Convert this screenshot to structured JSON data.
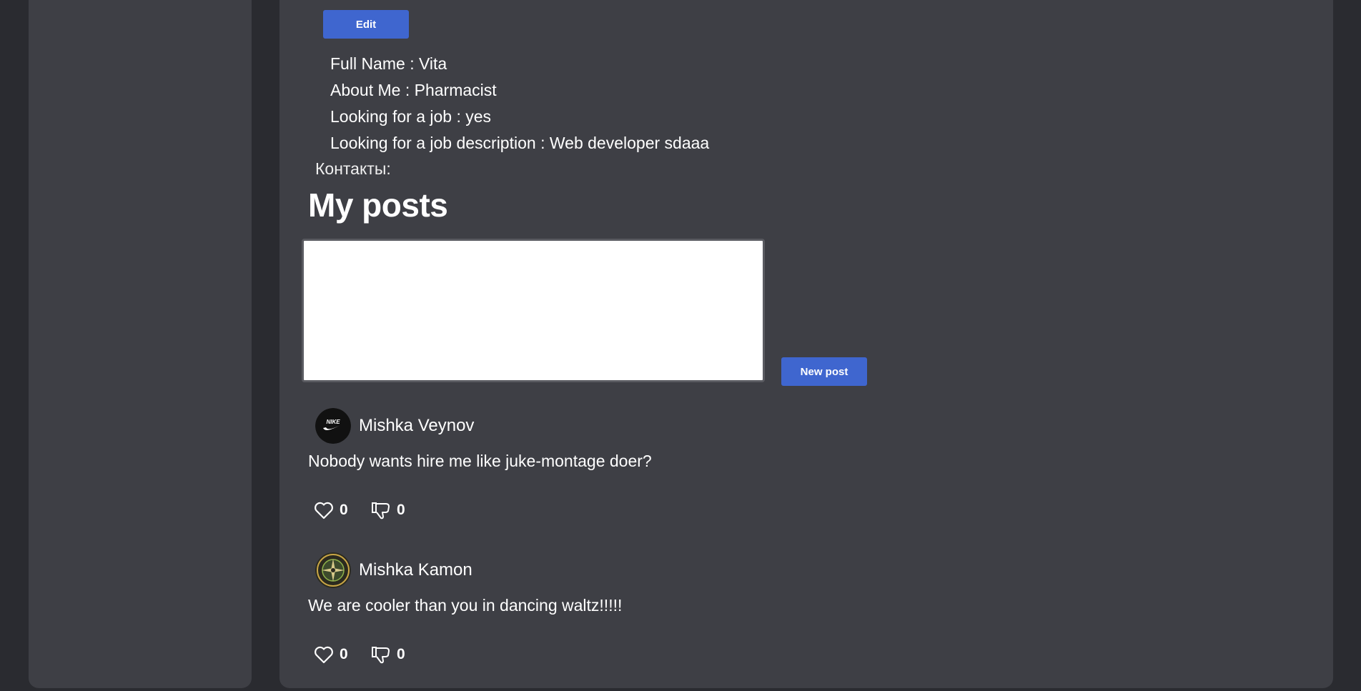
{
  "profile": {
    "edit_label": "Edit",
    "full_name": {
      "label": "Full Name",
      "value": ": Vita"
    },
    "about_me": {
      "label": "About Me",
      "value": ": Pharmacist"
    },
    "looking_for_job": {
      "label": "Looking for a job",
      "value": ": yes"
    },
    "job_description": {
      "label": "Looking for a job description",
      "value": ": Web developer sdaaa"
    },
    "contacts_label": "Контакты:"
  },
  "posts_section": {
    "title": "My posts",
    "textarea_value": "",
    "new_post_label": "New post"
  },
  "posts": [
    {
      "author": "Mishka Veynov",
      "avatar_icon": "nike-logo-icon",
      "text": "Nobody wants hire me like juke-montage doer?",
      "likes": "0",
      "dislikes": "0"
    },
    {
      "author": "Mishka Kamon",
      "avatar_icon": "compass-badge-icon",
      "text": "We are cooler than you in dancing waltz!!!!!",
      "likes": "0",
      "dislikes": "0"
    }
  ],
  "colors": {
    "background": "#2a2b30",
    "panel": "#3e3f45",
    "accent_button": "#3f66cf",
    "text": "#ffffff"
  }
}
